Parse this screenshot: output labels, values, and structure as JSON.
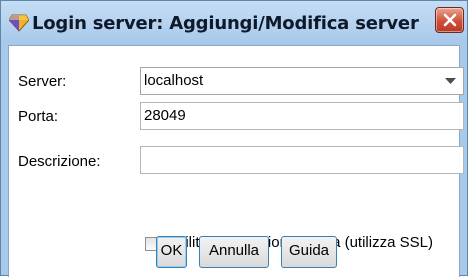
{
  "dialog": {
    "title": "Login server: Aggiungi/Modifica server",
    "app_icon": "diamond-app-icon",
    "close_icon": "close-icon"
  },
  "form": {
    "server": {
      "label": "Server:",
      "value": "localhost"
    },
    "porta": {
      "label": "Porta:",
      "value": "28049"
    },
    "descrizione": {
      "label": "Descrizione:",
      "value": ""
    },
    "ssl": {
      "label": "Abilita connessione sicura (utilizza SSL)",
      "checked": false
    }
  },
  "buttons": {
    "ok": "OK",
    "cancel": "Annulla",
    "help": "Guida"
  },
  "colors": {
    "title_bar": "#a9c9e8",
    "close_button": "#cf4f39",
    "focus_border": "#3c7fb1"
  }
}
